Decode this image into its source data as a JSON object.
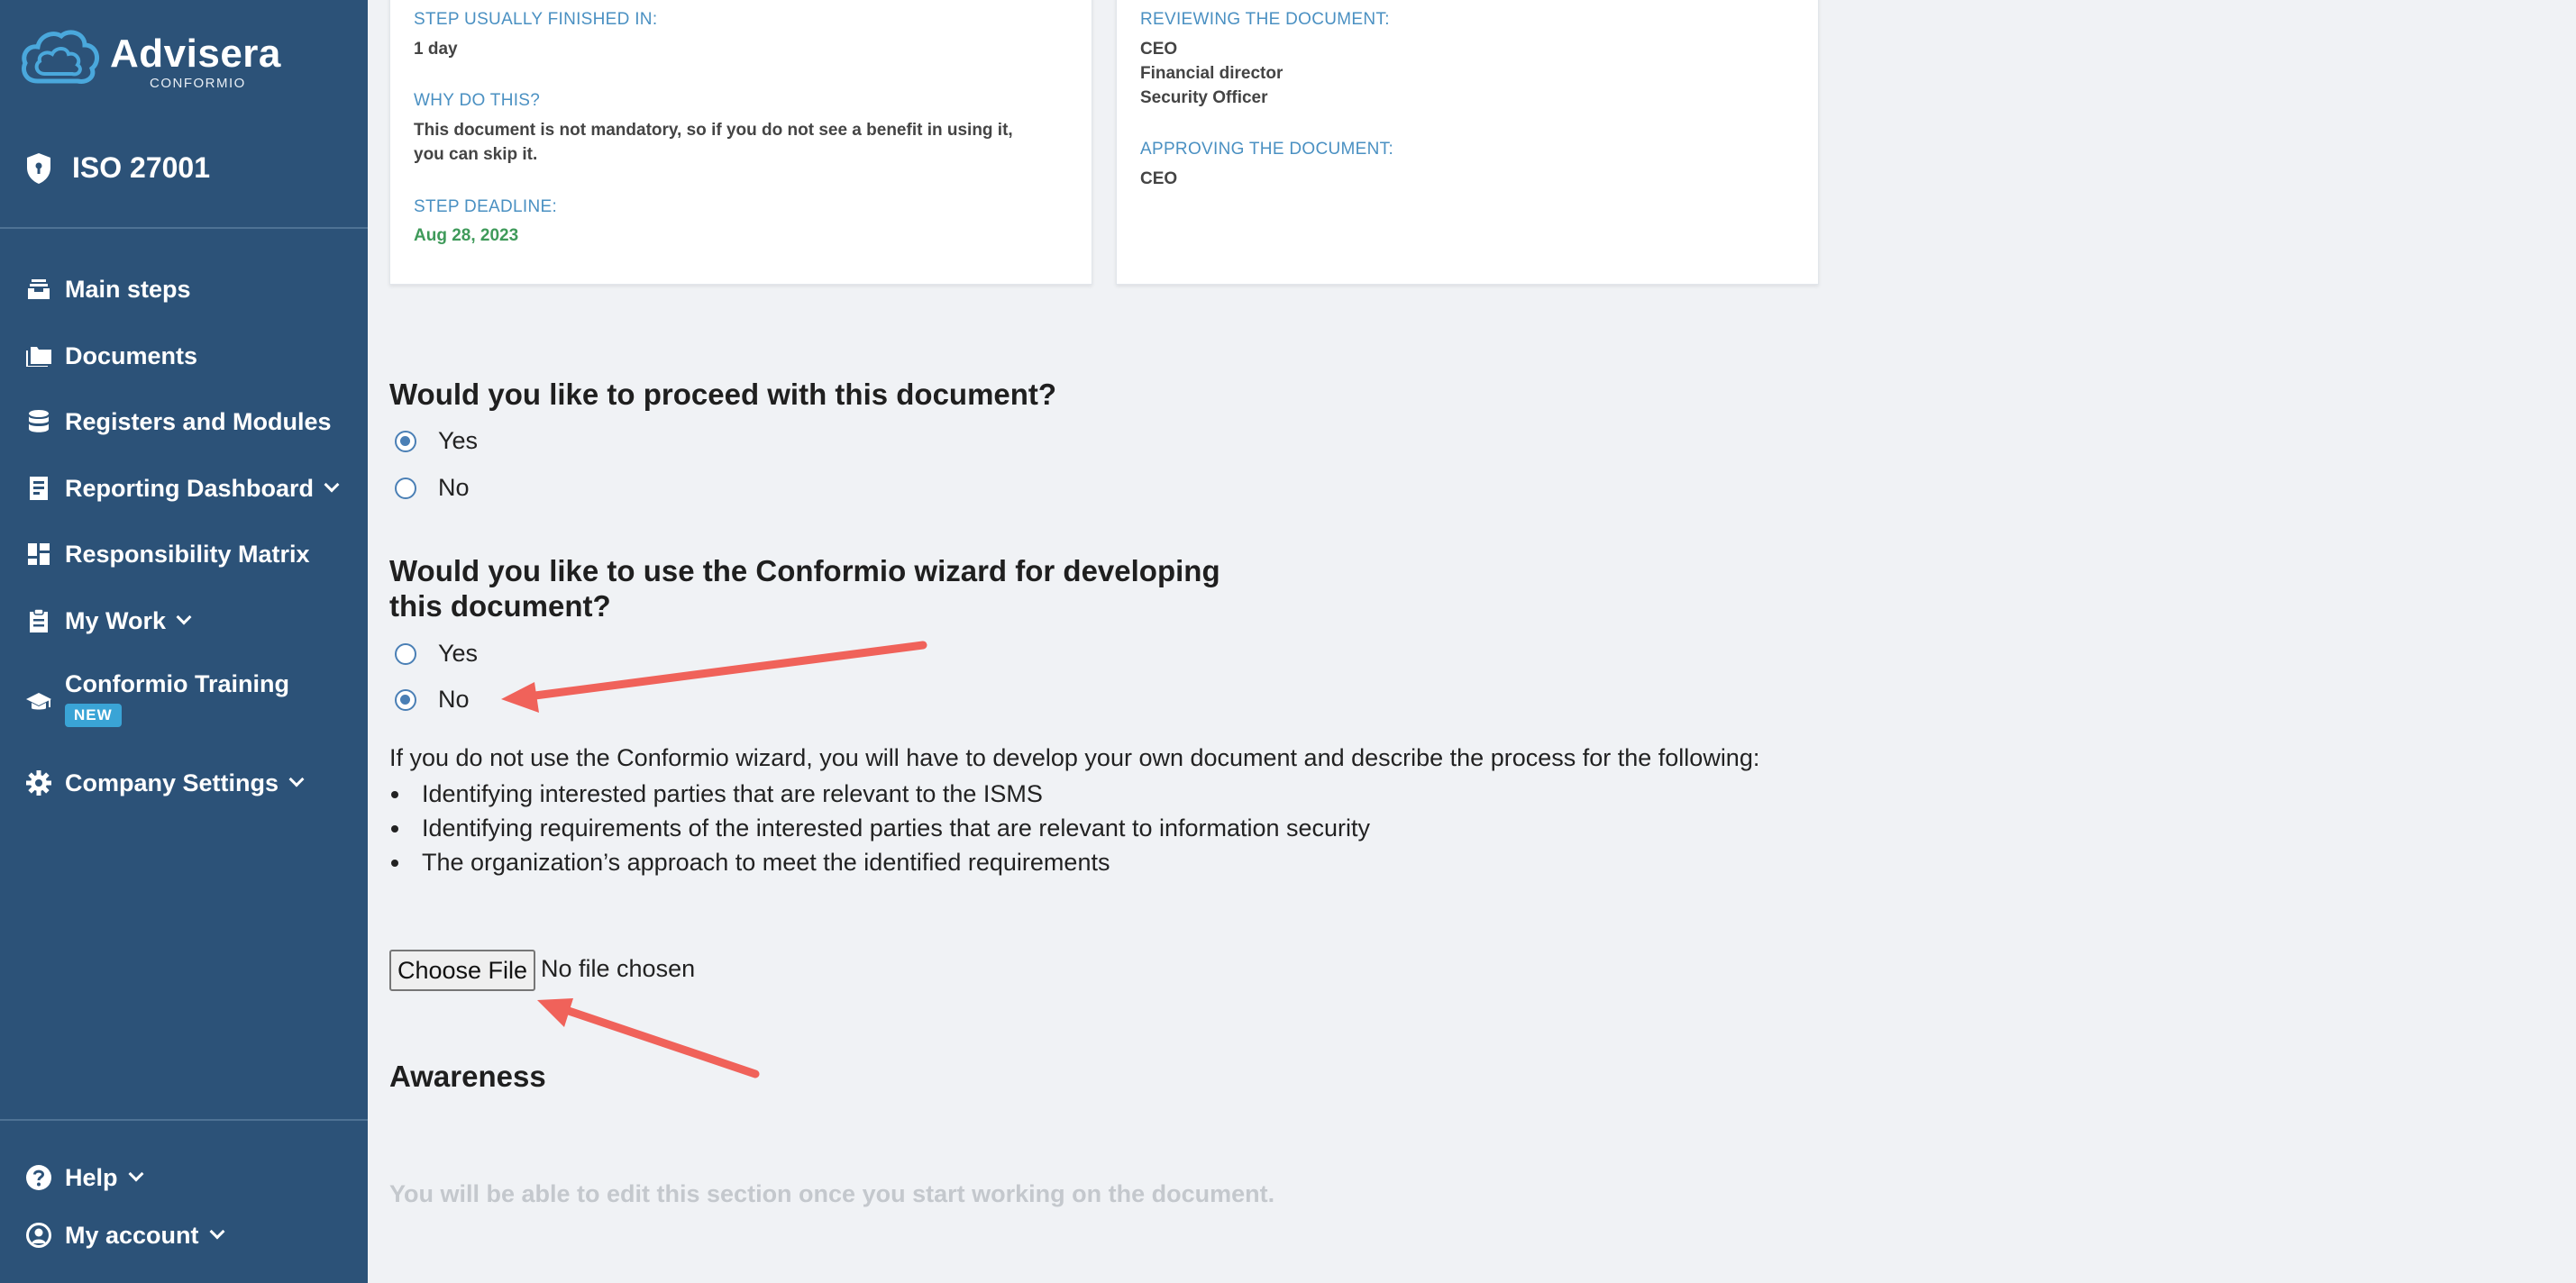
{
  "brand": {
    "name": "Advisera",
    "sub": "CONFORMIO"
  },
  "standard": {
    "label": "ISO 27001",
    "icon": "shield-icon"
  },
  "sidebar": {
    "items": [
      {
        "label": "Main steps",
        "icon": "inbox-stack-icon",
        "has_chevron": false
      },
      {
        "label": "Documents",
        "icon": "folders-icon",
        "has_chevron": false
      },
      {
        "label": "Registers and Modules",
        "icon": "database-icon",
        "has_chevron": false
      },
      {
        "label": "Reporting Dashboard",
        "icon": "report-icon",
        "has_chevron": true
      },
      {
        "label": "Responsibility Matrix",
        "icon": "dashboard-grid-icon",
        "has_chevron": false
      },
      {
        "label": "My Work",
        "icon": "clipboard-icon",
        "has_chevron": true
      },
      {
        "label": "Conformio Training",
        "icon": "graduation-cap-icon",
        "has_chevron": false,
        "badge": "NEW"
      },
      {
        "label": "Company Settings",
        "icon": "gear-icon",
        "has_chevron": true
      }
    ],
    "bottom": [
      {
        "label": "Help",
        "icon": "question-circle-icon",
        "has_chevron": true
      },
      {
        "label": "My account",
        "icon": "user-circle-icon",
        "has_chevron": true
      }
    ]
  },
  "step_card": {
    "finished_label": "STEP USUALLY FINISHED IN:",
    "finished_value": "1 day",
    "why_label": "WHY DO THIS?",
    "why_value_1": "This document is not mandatory, so if you do not see a benefit in using it,",
    "why_value_2": "you can skip it.",
    "deadline_label": "STEP DEADLINE:",
    "deadline_value": "Aug 28, 2023"
  },
  "review_card": {
    "reviewing_label": "REVIEWING THE DOCUMENT:",
    "reviewers": [
      "CEO",
      "Financial director",
      "Security Officer"
    ],
    "approving_label": "APPROVING THE DOCUMENT:",
    "approver": "CEO"
  },
  "q1": {
    "question": "Would you like to proceed with this document?",
    "options": [
      {
        "label": "Yes",
        "selected": true
      },
      {
        "label": "No",
        "selected": false
      }
    ]
  },
  "q2": {
    "question_line1": "Would you like to use the Conformio wizard for developing",
    "question_line2": "this document?",
    "options": [
      {
        "label": "Yes",
        "selected": false
      },
      {
        "label": "No",
        "selected": true
      }
    ]
  },
  "info": {
    "intro": "If you do not use the Conformio wizard, you will have to develop your own document and describe the process for the following:",
    "bullets": [
      "Identifying interested parties that are relevant to the ISMS",
      "Identifying requirements of the interested parties that are relevant to information security",
      "The organization’s approach to meet the identified requirements"
    ]
  },
  "file_input": {
    "button_label": "Choose File",
    "status": "No file chosen"
  },
  "awareness": {
    "heading": "Awareness",
    "hint": "You will be able to edit this section once you start working on the document."
  },
  "colors": {
    "sidebar_bg": "#2c5278",
    "label_blue": "#4a90c2",
    "deadline_green": "#3f9a5a",
    "annotation_arrow": "#f0625a",
    "badge_blue": "#3aa4d6"
  }
}
